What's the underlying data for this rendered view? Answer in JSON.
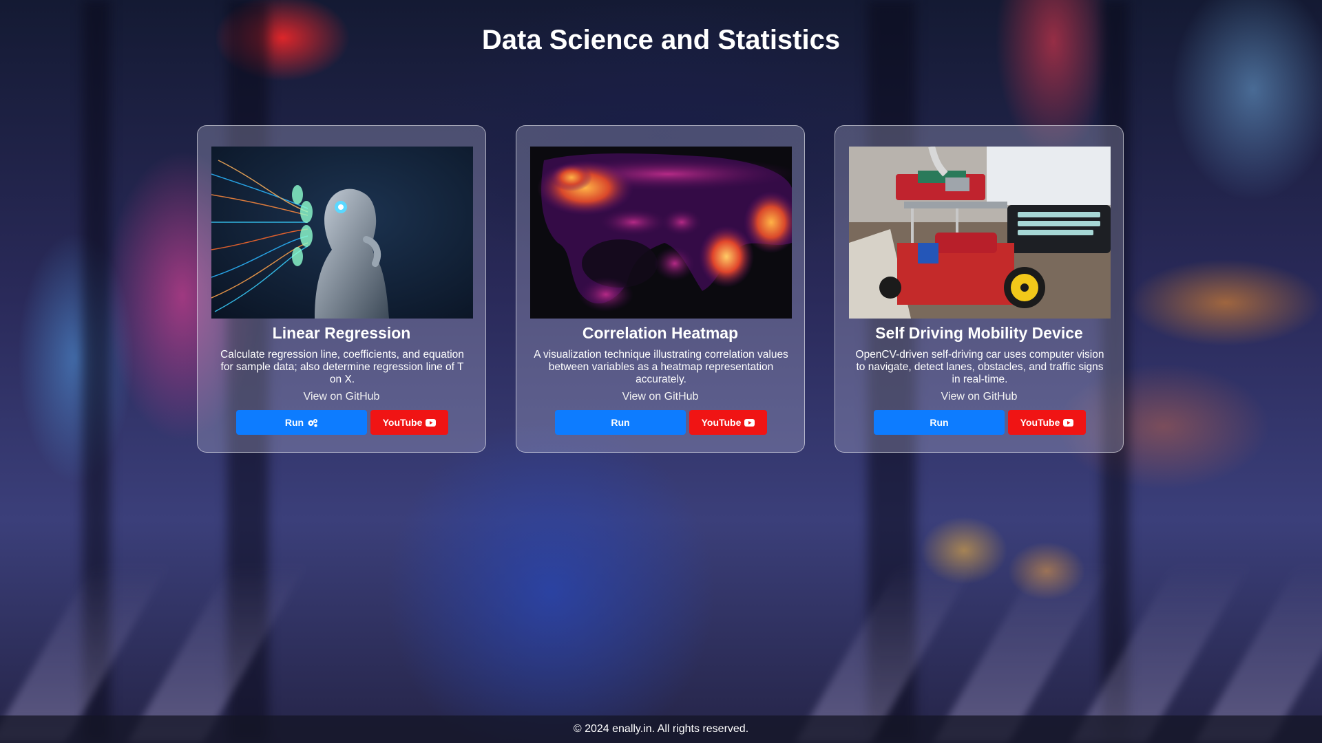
{
  "page": {
    "title": "Data Science and Statistics"
  },
  "cards": [
    {
      "title": "Linear Regression",
      "description": "Calculate regression line, coefficients, and equation for sample data; also determine regression line of T on X.",
      "github_label": "View on GitHub",
      "run_label": "Run",
      "run_icon": "gears-icon",
      "youtube_label": "YouTube",
      "youtube_icon": "youtube-icon",
      "image": "ai-robot-thinking-image"
    },
    {
      "title": "Correlation Heatmap",
      "description": "A visualization technique illustrating correlation values between variables as a heatmap representation accurately.",
      "github_label": "View on GitHub",
      "run_label": "Run",
      "youtube_label": "YouTube",
      "youtube_icon": "youtube-icon",
      "image": "world-heatmap-image"
    },
    {
      "title": "Self Driving Mobility Device",
      "description": "OpenCV-driven self-driving car uses computer vision to navigate, detect lanes, obstacles, and traffic signs in real-time.",
      "github_label": "View on GitHub",
      "run_label": "Run",
      "youtube_label": "YouTube",
      "youtube_icon": "youtube-icon",
      "image": "robot-car-image"
    }
  ],
  "footer": {
    "text": "© 2024 enally.in. All rights reserved."
  },
  "colors": {
    "run_button": "#0d7cff",
    "youtube_button": "#f01414",
    "text": "#ffffff"
  }
}
